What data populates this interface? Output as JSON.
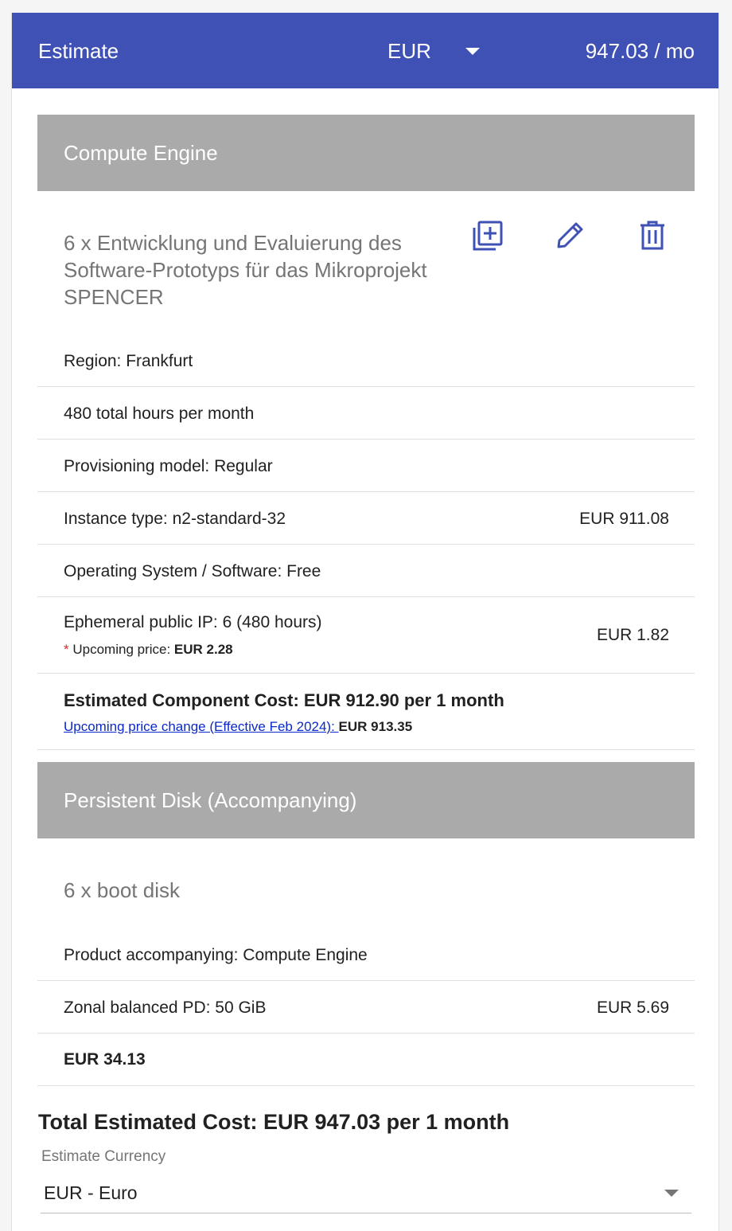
{
  "header": {
    "title": "Estimate",
    "currency": "EUR",
    "total": "947.03 / mo"
  },
  "sections": [
    {
      "band_title": "Compute Engine",
      "item_title": "6 x Entwicklung und Evaluierung des Software-Prototyps für das Mikroprojekt SPENCER",
      "actions": [
        {
          "icon": "duplicate-icon"
        },
        {
          "icon": "edit-pencil-icon"
        },
        {
          "icon": "delete-trash-icon"
        }
      ],
      "rows": [
        {
          "label": "Region: Frankfurt",
          "price": ""
        },
        {
          "label": "480 total hours per month",
          "price": ""
        },
        {
          "label": "Provisioning model: Regular",
          "price": ""
        },
        {
          "label": "Instance type: n2-standard-32",
          "price": "EUR 911.08"
        },
        {
          "label": "Operating System / Software: Free",
          "price": ""
        },
        {
          "label": "Ephemeral public IP: 6 (480 hours)",
          "price": "EUR 1.82",
          "note_star": "*",
          "note_prefix": "Upcoming price:",
          "note_value": "EUR 2.28"
        }
      ],
      "component_cost": "Estimated Component Cost: EUR 912.90 per 1 month",
      "upcoming_link": "Upcoming price change (Effective Feb 2024): ",
      "upcoming_value": "EUR 913.35"
    },
    {
      "band_title": "Persistent Disk (Accompanying)",
      "item_title": "6 x boot disk",
      "rows": [
        {
          "label": "Product accompanying: Compute Engine",
          "price": ""
        },
        {
          "label": "Zonal balanced PD: 50 GiB",
          "price": "EUR 5.69"
        }
      ],
      "subtotal": "EUR 34.13"
    }
  ],
  "total_estimated_cost": "Total Estimated Cost: EUR 947.03 per 1 month",
  "estimate_currency": {
    "label": "Estimate Currency",
    "value": "EUR - Euro"
  },
  "colors": {
    "header_bg": "#3f51b5",
    "band_bg": "#aaaaaa",
    "icon": "#3f51b5",
    "link": "#0b29c8",
    "asterisk": "#d32f2f"
  }
}
